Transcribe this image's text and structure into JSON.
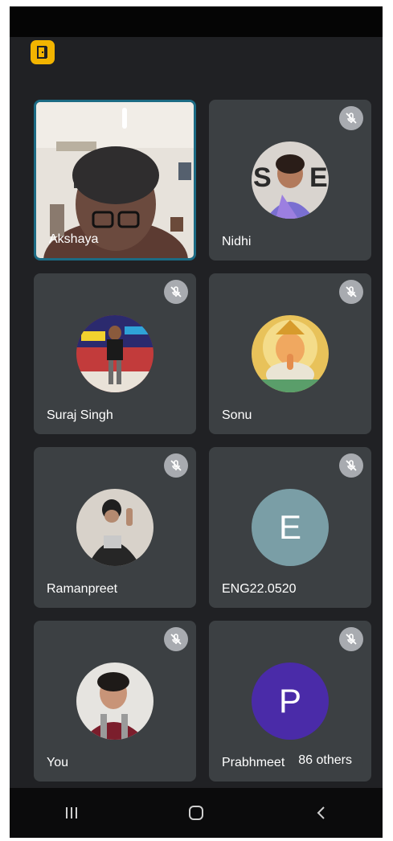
{
  "app": {
    "badge_icon": "exit-door-icon",
    "badge_color": "#f2b400"
  },
  "participants": [
    {
      "name": "Akshaya",
      "muted": false,
      "video": true
    },
    {
      "name": "Nidhi",
      "muted": true,
      "avatar_type": "photo"
    },
    {
      "name": "Suraj Singh",
      "muted": true,
      "avatar_type": "photo"
    },
    {
      "name": "Sonu",
      "muted": true,
      "avatar_type": "photo"
    },
    {
      "name": "Ramanpreet",
      "muted": true,
      "avatar_type": "photo"
    },
    {
      "name": "ENG22.0520",
      "muted": true,
      "avatar_type": "letter",
      "letter": "E",
      "avatar_color": "#7a9ea6"
    },
    {
      "name": "You",
      "muted": true,
      "avatar_type": "photo"
    },
    {
      "name": "Prabhmeet Singh",
      "muted": true,
      "avatar_type": "letter",
      "letter": "P",
      "avatar_color": "#4a2ba8"
    }
  ],
  "others": {
    "label": "86 others"
  },
  "navbar": {
    "icons": [
      "recent-apps-icon",
      "home-icon",
      "back-icon"
    ]
  }
}
